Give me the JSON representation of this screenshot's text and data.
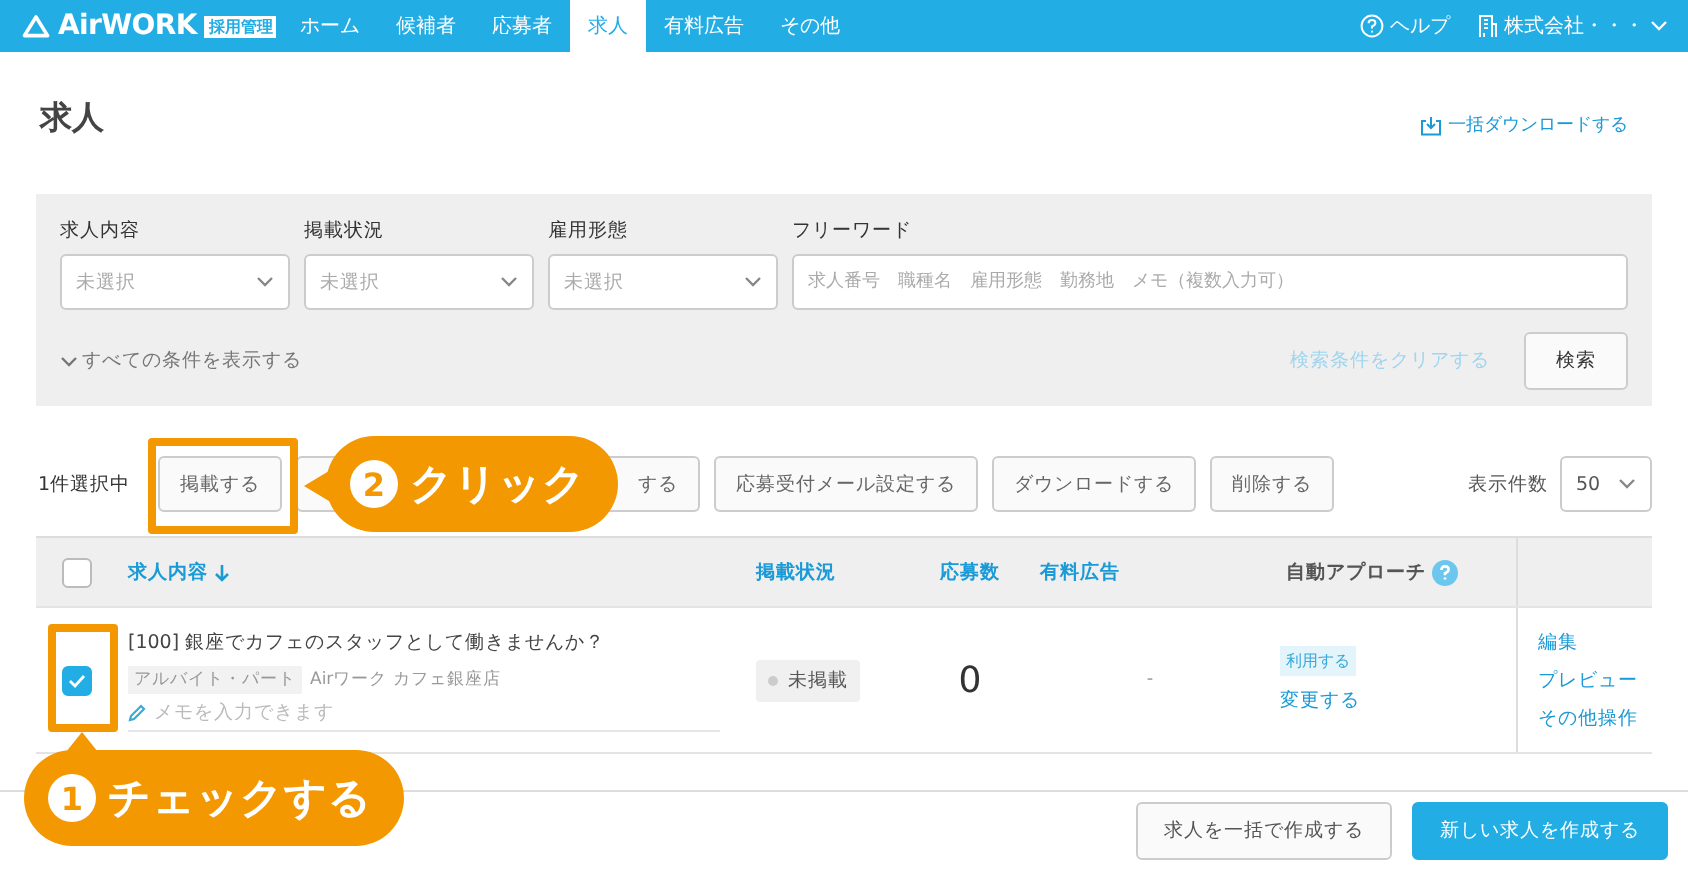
{
  "header": {
    "logo": "AirWORK",
    "badge": "採用管理",
    "nav": [
      {
        "label": "ホーム",
        "selected": false
      },
      {
        "label": "候補者",
        "selected": false
      },
      {
        "label": "応募者",
        "selected": false
      },
      {
        "label": "求人",
        "selected": true
      },
      {
        "label": "有料広告",
        "selected": false
      },
      {
        "label": "その他",
        "selected": false
      }
    ],
    "help": "ヘルプ",
    "account": "株式会社・・・"
  },
  "page_title": "求人",
  "download_link": "一括ダウンロードする",
  "filters": {
    "selects": [
      {
        "label": "求人内容",
        "placeholder": "未選択"
      },
      {
        "label": "掲載状況",
        "placeholder": "未選択"
      },
      {
        "label": "雇用形態",
        "placeholder": "未選択"
      }
    ],
    "free_word": {
      "label": "フリーワード",
      "placeholder": "求人番号　職種名　雇用形態　勤務地　メモ（複数入力可）"
    },
    "show_all": "すべての条件を表示する",
    "clear_link": "検索条件をクリアする",
    "search_button": "検索"
  },
  "toolbar": {
    "selection_count": "1件選択中",
    "buttons": [
      {
        "label": "掲載する",
        "kind": "normal"
      },
      {
        "label": "する",
        "kind": "covered"
      },
      {
        "label": "応募受付メール設定する",
        "kind": "normal"
      },
      {
        "label": "ダウンロードする",
        "kind": "normal"
      },
      {
        "label": "削除する",
        "kind": "normal"
      }
    ],
    "per_page": {
      "label": "表示件数",
      "value": "50"
    }
  },
  "table": {
    "all_checked": false,
    "columns": [
      {
        "label": "求人内容",
        "kind": "sorted"
      },
      {
        "label": "掲載状況",
        "kind": "link"
      },
      {
        "label": "応募数",
        "kind": "link"
      },
      {
        "label": "有料広告",
        "kind": "link"
      },
      {
        "label": "自動アプローチ",
        "kind": "help"
      }
    ],
    "rows": [
      {
        "checked": true,
        "title": "[100] 銀座でカフェのスタッフとして働きませんか？",
        "employment_type": "アルバイト・パート",
        "store": "Airワーク カフェ銀座店",
        "memo_placeholder": "メモを入力できます",
        "status": "未掲載",
        "applicants": "0",
        "paid_ad": "-",
        "auto_approach_tag": "利用する",
        "auto_approach_link": "変更する",
        "actions": [
          "編集",
          "プレビュー",
          "その他操作"
        ]
      }
    ]
  },
  "footer": {
    "buttons": [
      {
        "label": "求人を一括で作成する",
        "kind": "secondary"
      },
      {
        "label": "新しい求人を作成する",
        "kind": "primary"
      }
    ]
  },
  "annotations": [
    {
      "number": "2",
      "text": "クリック"
    },
    {
      "number": "1",
      "text": "チェックする"
    }
  ]
}
